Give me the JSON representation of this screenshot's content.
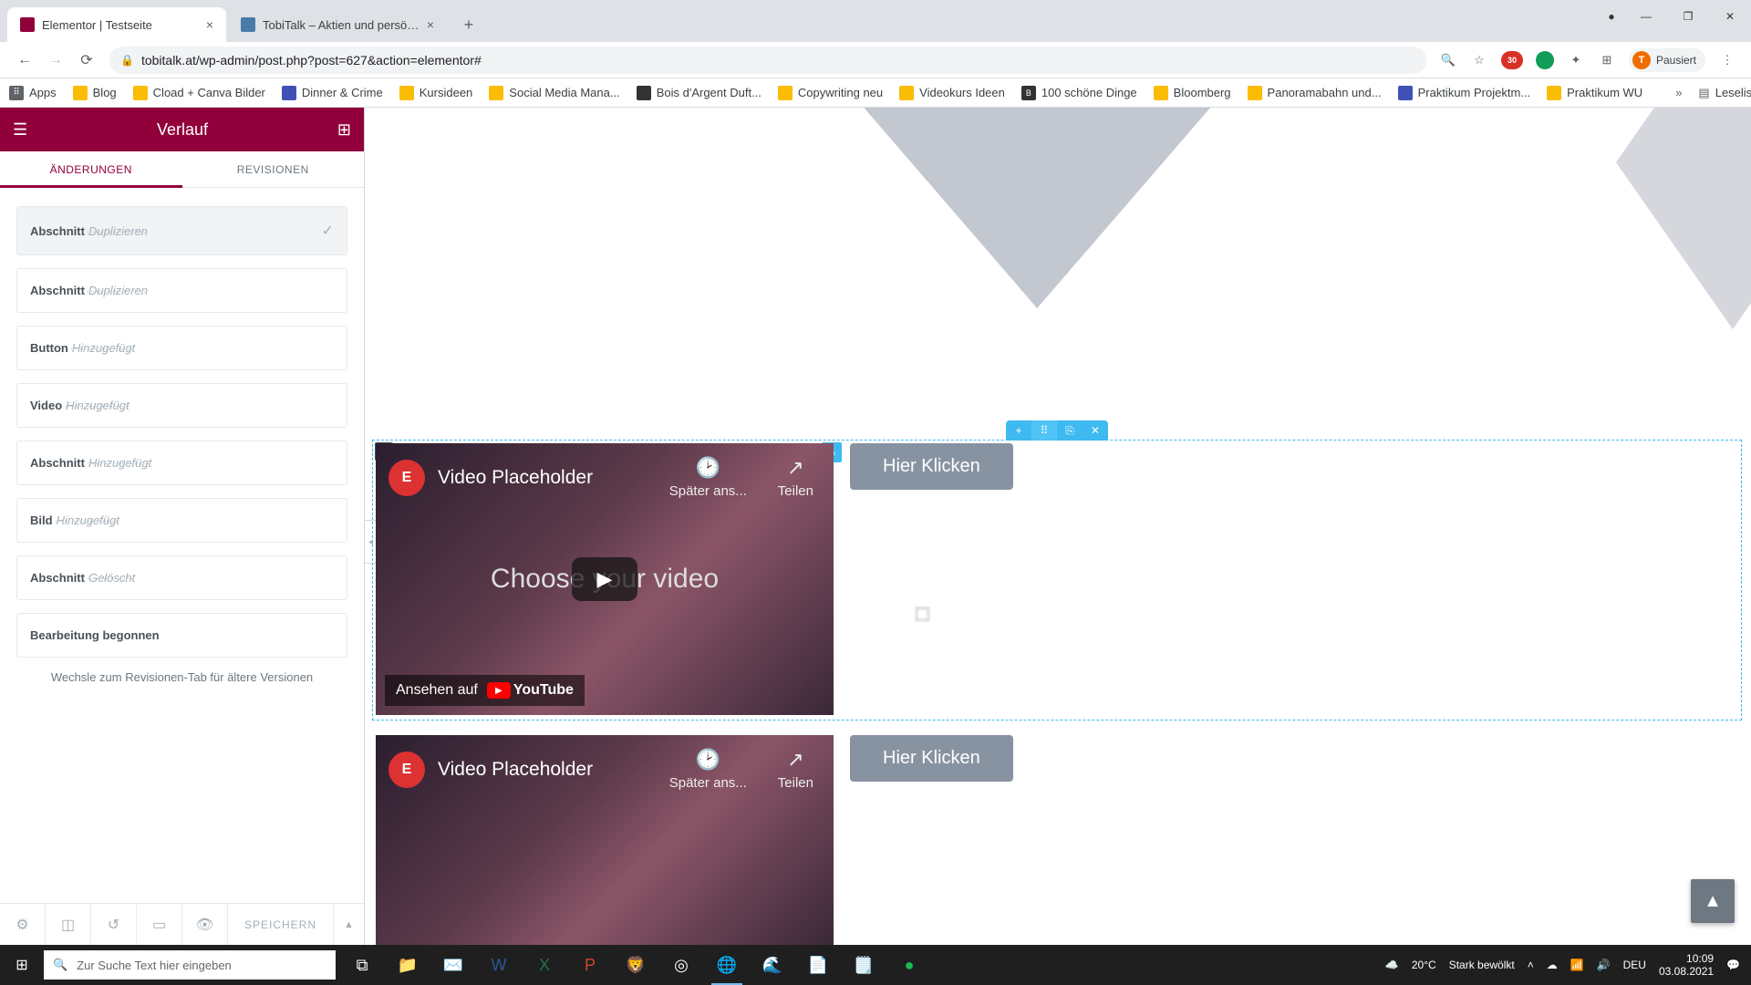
{
  "browser": {
    "tabs": [
      {
        "title": "Elementor | Testseite"
      },
      {
        "title": "TobiTalk – Aktien und persönlich"
      }
    ],
    "url": "tobitalk.at/wp-admin/post.php?post=627&action=elementor#",
    "profile_label": "Pausiert",
    "profile_initial": "T"
  },
  "bookmarks": {
    "items": [
      "Apps",
      "Blog",
      "Cload + Canva Bilder",
      "Dinner & Crime",
      "Kursideen",
      "Social Media Mana...",
      "Bois d'Argent Duft...",
      "Copywriting neu",
      "Videokurs Ideen",
      "100 schöne Dinge",
      "Bloomberg",
      "Panoramabahn und...",
      "Praktikum Projektm...",
      "Praktikum WU"
    ],
    "readlist": "Leseliste"
  },
  "panel": {
    "title": "Verlauf",
    "tabs": {
      "changes": "ÄNDERUNGEN",
      "revisions": "REVISIONEN"
    },
    "history": [
      {
        "widget": "Abschnitt",
        "action": "Duplizieren",
        "current": true
      },
      {
        "widget": "Abschnitt",
        "action": "Duplizieren"
      },
      {
        "widget": "Button",
        "action": "Hinzugefügt"
      },
      {
        "widget": "Video",
        "action": "Hinzugefügt"
      },
      {
        "widget": "Abschnitt",
        "action": "Hinzugefügt"
      },
      {
        "widget": "Bild",
        "action": "Hinzugefügt"
      },
      {
        "widget": "Abschnitt",
        "action": "Gelöscht"
      },
      {
        "widget": "Bearbeitung begonnen",
        "action": ""
      }
    ],
    "note": "Wechsle zum Revisionen-Tab für ältere Versionen",
    "save": "SPEICHERN"
  },
  "canvas": {
    "video_title": "Video Placeholder",
    "later": "Später ans...",
    "share": "Teilen",
    "center": "Choose your video",
    "watch_on": "Ansehen auf",
    "yt": "YouTube",
    "button_label": "Hier Klicken"
  },
  "taskbar": {
    "search_placeholder": "Zur Suche Text hier eingeben",
    "weather_temp": "20°C",
    "weather_desc": "Stark bewölkt",
    "lang": "DEU",
    "time": "10:09",
    "date": "03.08.2021"
  }
}
